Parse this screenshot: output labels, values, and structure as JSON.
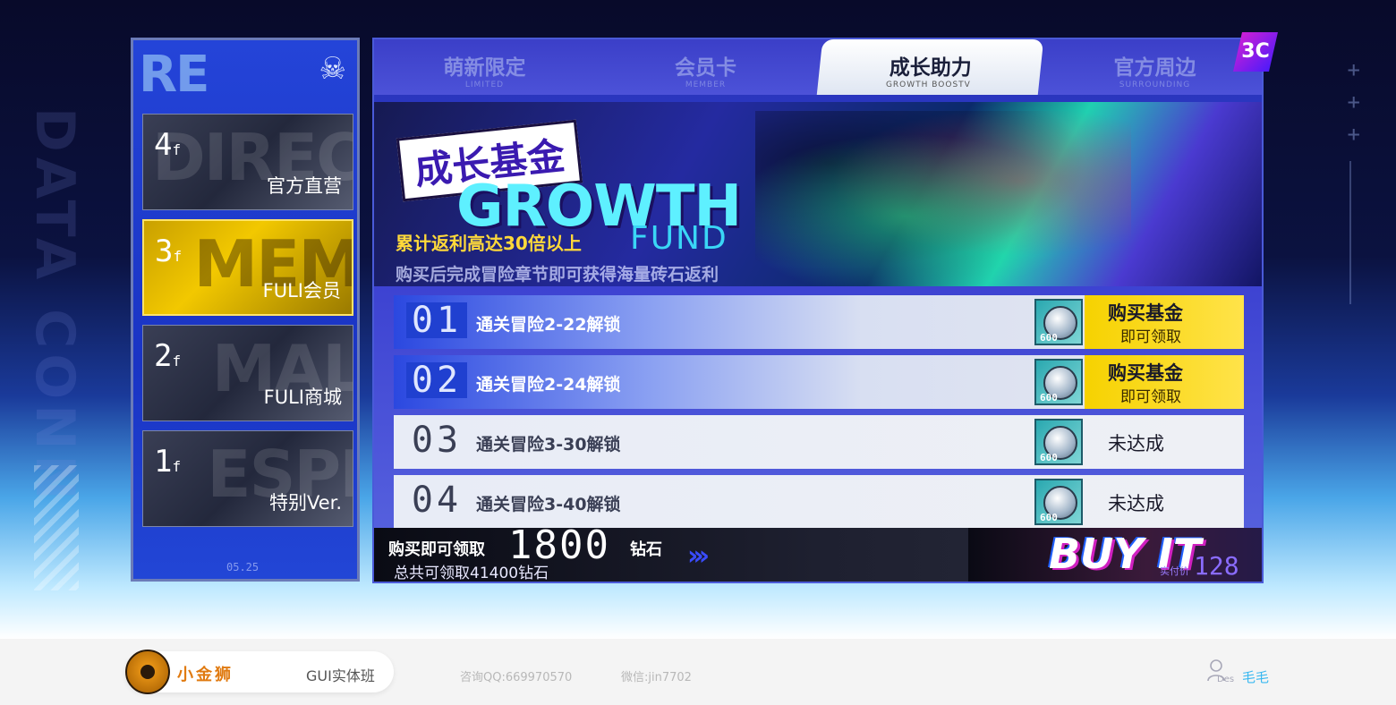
{
  "colors": {
    "accent": "#f6d200",
    "brand": "#e07a10",
    "tab_active_bg": "#ffffff",
    "link": "#3ab8f0"
  },
  "floors": [
    {
      "num": "4",
      "suffix": "f",
      "label": "官方直营",
      "bg_text": "DIREC"
    },
    {
      "num": "3",
      "suffix": "f",
      "label": "FULI会员",
      "bg_text": "MEM"
    },
    {
      "num": "2",
      "suffix": "f",
      "label": "FULI商城",
      "bg_text": "MAL"
    },
    {
      "num": "1",
      "suffix": "f",
      "label": "特别Ver.",
      "bg_text": "ESPI"
    }
  ],
  "left_panel": {
    "foot": "05.25",
    "logo": "RE"
  },
  "tabs": [
    {
      "cn": "萌新限定",
      "en": "LIMITED"
    },
    {
      "cn": "会员卡",
      "en": "MEMBER"
    },
    {
      "cn": "成长助力",
      "en": "GROWTH BOOSTV"
    },
    {
      "cn": "官方周边",
      "en": "SURROUNDING"
    }
  ],
  "banner": {
    "title_cn": "成长基金",
    "title_en": "GROWTH",
    "fund": "FUND",
    "rebate": "累计返利高达30倍以上",
    "subline": "购买后完成冒险章节即可获得海量砖石返利"
  },
  "tasks": [
    {
      "num": "01",
      "desc": "通关冒险2-22解锁",
      "gem": "600",
      "action": "购买基金",
      "action_sub": "即可领取",
      "state": "claim"
    },
    {
      "num": "02",
      "desc": "通关冒险2-24解锁",
      "gem": "600",
      "action": "购买基金",
      "action_sub": "即可领取",
      "state": "claim"
    },
    {
      "num": "03",
      "desc": "通关冒险3-30解锁",
      "gem": "600",
      "action": "未达成",
      "action_sub": "",
      "state": "done"
    },
    {
      "num": "04",
      "desc": "通关冒险3-40解锁",
      "gem": "600",
      "action": "未达成",
      "action_sub": "",
      "state": "done"
    }
  ],
  "buybar": {
    "line1": "购买即可领取",
    "amount": "1800",
    "unit": "钻石",
    "line2": "总共可领取41400钻石",
    "arrows": "›››",
    "button": "BUY IT",
    "price_label": "实付价",
    "price": "128"
  },
  "footer": {
    "brand": "小金狮",
    "class": "GUI实体班",
    "qq": "咨询QQ:669970570",
    "wechat": "微信:jin7702",
    "des": "Des",
    "user": "毛毛"
  },
  "corner_logo": "3C"
}
